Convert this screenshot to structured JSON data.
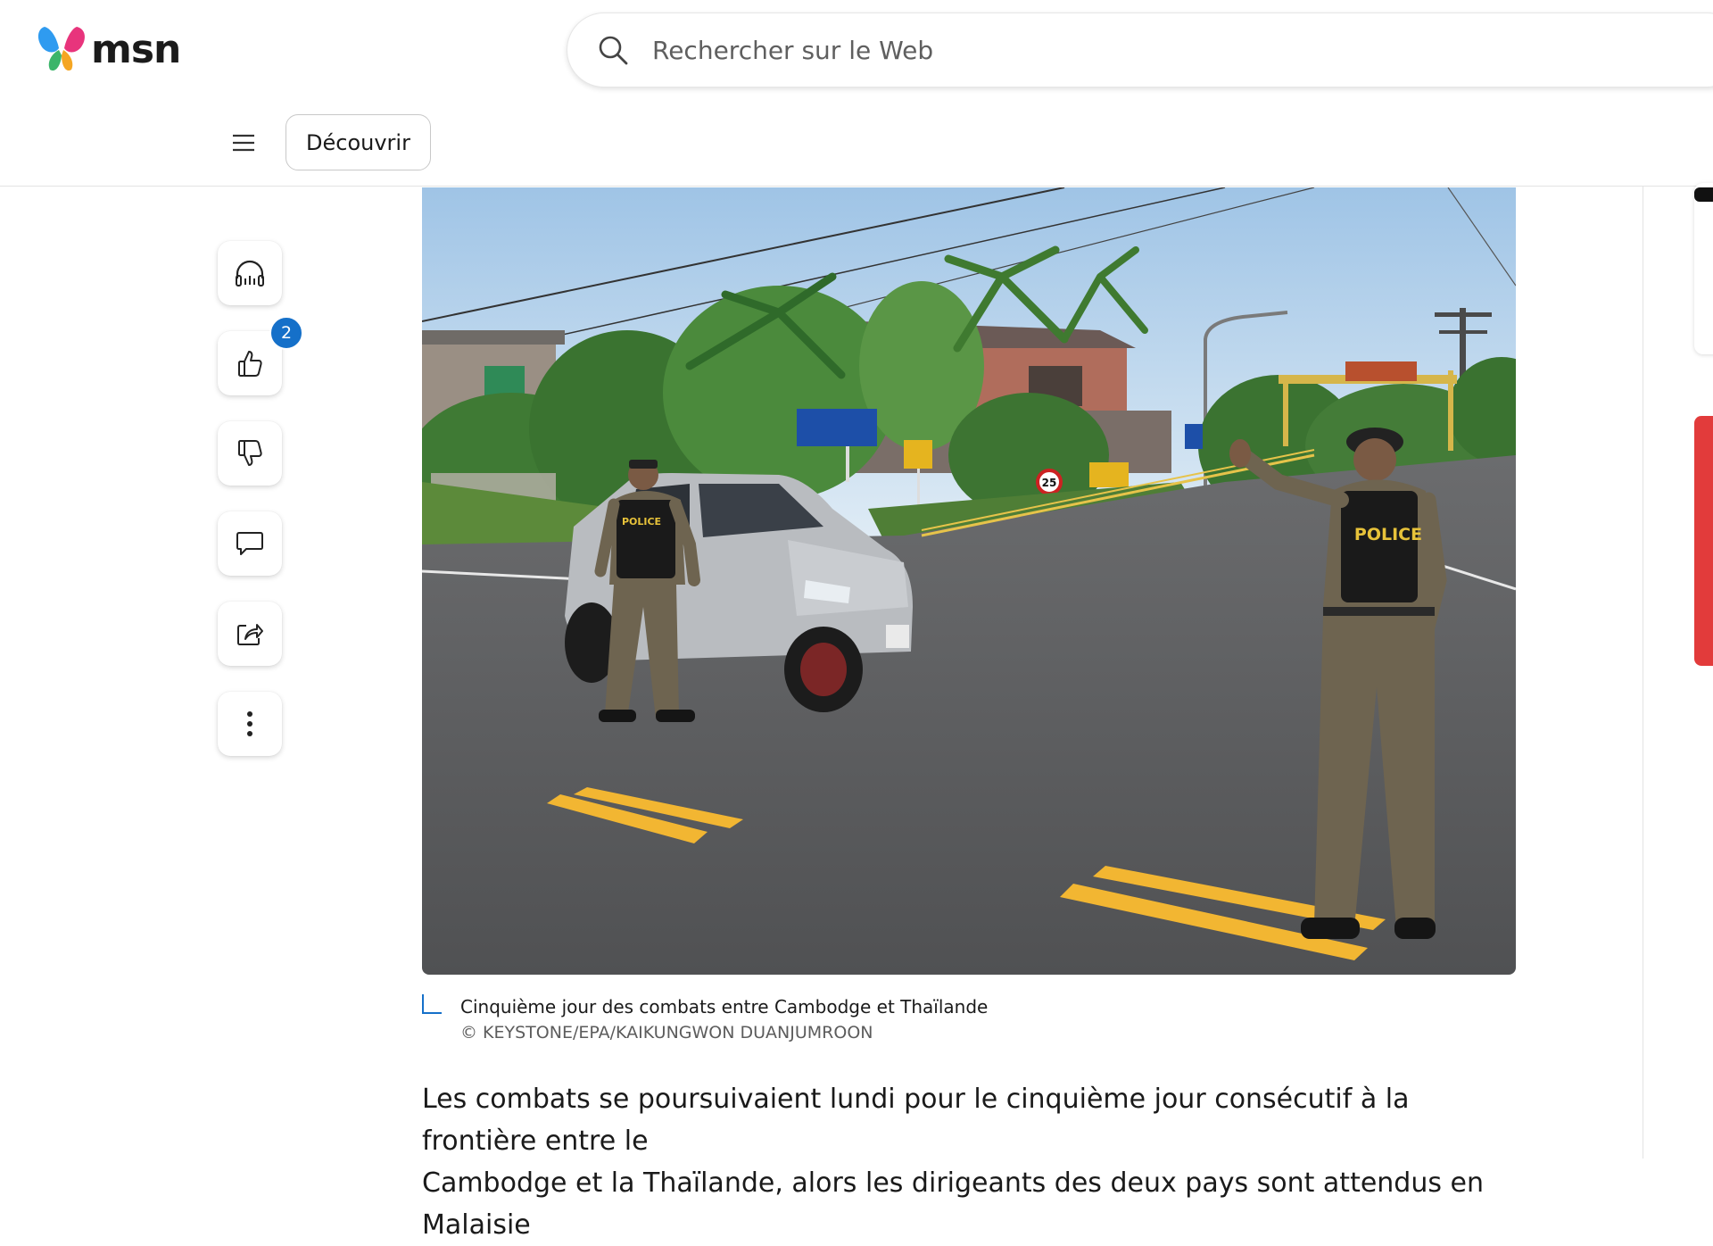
{
  "app": {
    "logo_text": "msn"
  },
  "search": {
    "placeholder": "Rechercher sur le Web",
    "icon": "search-icon"
  },
  "nav": {
    "menu_icon": "hamburger-menu-icon",
    "discover_label": "Découvrir"
  },
  "rail": {
    "items": [
      {
        "icon": "headphones-icon",
        "label": "listen"
      },
      {
        "icon": "thumbs-up-icon",
        "label": "like",
        "badge": "2"
      },
      {
        "icon": "thumbs-down-icon",
        "label": "dislike"
      },
      {
        "icon": "comment-icon",
        "label": "comment"
      },
      {
        "icon": "share-icon",
        "label": "share"
      },
      {
        "icon": "more-vertical-icon",
        "label": "more"
      }
    ],
    "like_badge": "2"
  },
  "article": {
    "image_alt": "Police officers stopping a silver car at a border crossing road",
    "caption": "Cinquième jour des combats entre Cambodge et Thaïlande",
    "credit": "© KEYSTONE/EPA/KAIKUNGWON DUANJUMROON",
    "body_line_1": "Les combats se poursuivaient lundi pour le cinquième jour consécutif à la frontière entre le",
    "body_line_2": "Cambodge et la Thaïlande, alors les dirigeants des deux pays sont attendus en Malaisie",
    "police_label": "POLICE",
    "speed_sign": "25"
  },
  "colors": {
    "accent": "#1570c9",
    "road": "#5c5d5f",
    "road_line": "#f2b632",
    "sky": "#bfd9ee",
    "foliage": "#3e7a34",
    "uniform": "#6e6450",
    "car": "#b9bcc0",
    "ad_red": "#e23b3b"
  }
}
